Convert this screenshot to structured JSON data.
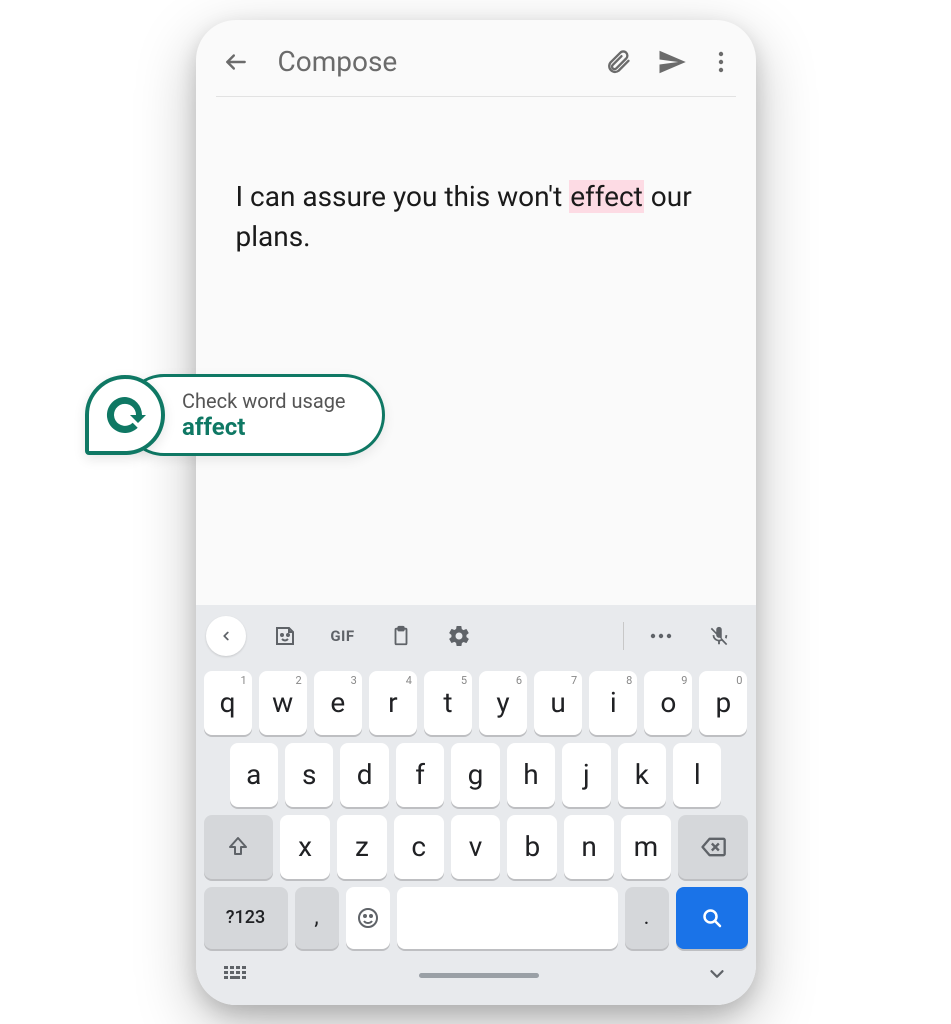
{
  "header": {
    "title": "Compose"
  },
  "message": {
    "before": "I can assure you this won't ",
    "highlight": "effect",
    "after": " our plans."
  },
  "suggestion": {
    "title": "Check word usage",
    "word": "affect"
  },
  "keyboard": {
    "gif_label": "GIF",
    "row1": [
      {
        "k": "q",
        "n": "1"
      },
      {
        "k": "w",
        "n": "2"
      },
      {
        "k": "e",
        "n": "3"
      },
      {
        "k": "r",
        "n": "4"
      },
      {
        "k": "t",
        "n": "5"
      },
      {
        "k": "y",
        "n": "6"
      },
      {
        "k": "u",
        "n": "7"
      },
      {
        "k": "i",
        "n": "8"
      },
      {
        "k": "o",
        "n": "9"
      },
      {
        "k": "p",
        "n": "0"
      }
    ],
    "row2": [
      "a",
      "s",
      "d",
      "f",
      "g",
      "h",
      "j",
      "k",
      "l"
    ],
    "row3": [
      "x",
      "z",
      "c",
      "v",
      "b",
      "n",
      "m"
    ],
    "mode_label": "?123",
    "comma": ",",
    "period": "."
  }
}
